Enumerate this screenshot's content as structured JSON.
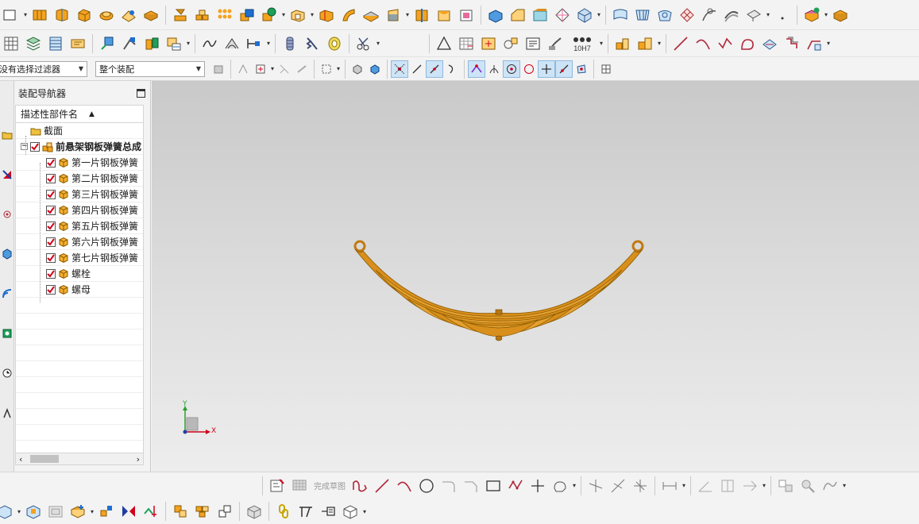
{
  "selection_filter": {
    "value": "没有选择过滤器"
  },
  "assembly_scope": {
    "value": "整个装配"
  },
  "navigator": {
    "title": "装配导航器",
    "column_header": "描述性部件名",
    "items": [
      {
        "label": "截面",
        "level": 1,
        "checked": false,
        "type": "folder"
      },
      {
        "label": "前悬架钢板弹簧总成",
        "level": 1,
        "checked": true,
        "type": "assembly"
      },
      {
        "label": "第一片钢板弹簧",
        "level": 2,
        "checked": true,
        "type": "part"
      },
      {
        "label": "第二片钢板弹簧",
        "level": 2,
        "checked": true,
        "type": "part"
      },
      {
        "label": "第三片钢板弹簧",
        "level": 2,
        "checked": true,
        "type": "part"
      },
      {
        "label": "第四片钢板弹簧",
        "level": 2,
        "checked": true,
        "type": "part"
      },
      {
        "label": "第五片钢板弹簧",
        "level": 2,
        "checked": true,
        "type": "part"
      },
      {
        "label": "第六片钢板弹簧",
        "level": 2,
        "checked": true,
        "type": "part"
      },
      {
        "label": "第七片钢板弹簧",
        "level": 2,
        "checked": true,
        "type": "part"
      },
      {
        "label": "螺栓",
        "level": 2,
        "checked": true,
        "type": "part"
      },
      {
        "label": "螺母",
        "level": 2,
        "checked": true,
        "type": "part"
      }
    ]
  },
  "sketch_toolbar": {
    "finish_label": "完成草图"
  },
  "toolbar": {
    "tolerance_label": "10H7"
  },
  "triad": {
    "x_label": "X",
    "y_label": "Y"
  },
  "colors": {
    "model": "#d98f1c",
    "check": "#d0021b",
    "accent": "#1f6fd0"
  }
}
